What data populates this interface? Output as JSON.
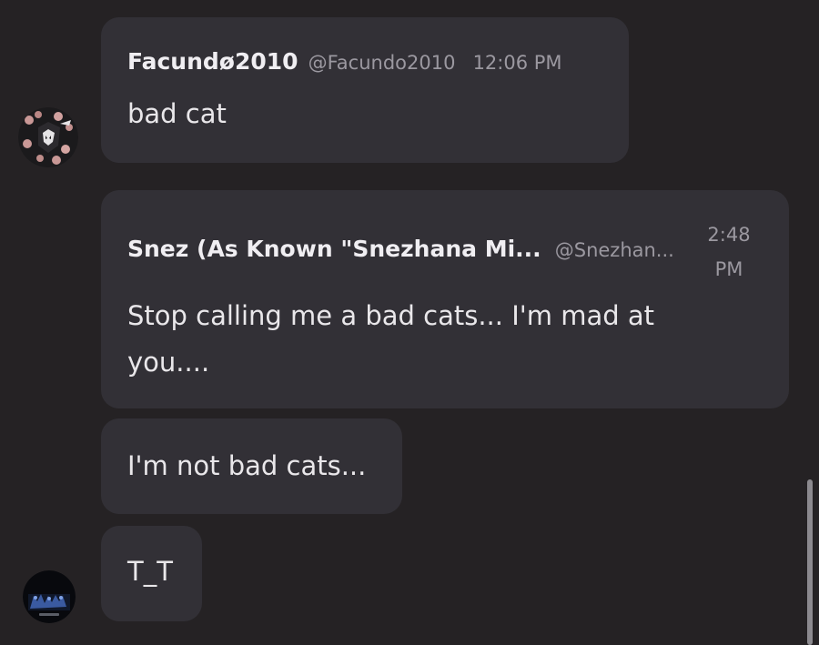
{
  "messages": [
    {
      "author": "Facundø2010",
      "handle": "@Facundo2010",
      "time": "12:06 PM",
      "text": "bad cat"
    },
    {
      "author": "Snez (As Known \"Snezhana Mi...",
      "handle": "@Snezhan...",
      "time_line1": "2:48",
      "time_line2": "PM",
      "text_line1": "Stop calling me a bad cats... I'm mad at",
      "text_line2": "you...."
    },
    {
      "text": "I'm not bad cats..."
    },
    {
      "text": "T_T"
    }
  ],
  "icons": {
    "avatar_1": "user-avatar-icon",
    "avatar_2": "user-avatar-icon"
  },
  "colors": {
    "background": "#252224",
    "bubble": "#323036",
    "text": "#e9e7ea",
    "muted": "#9b98a0"
  }
}
